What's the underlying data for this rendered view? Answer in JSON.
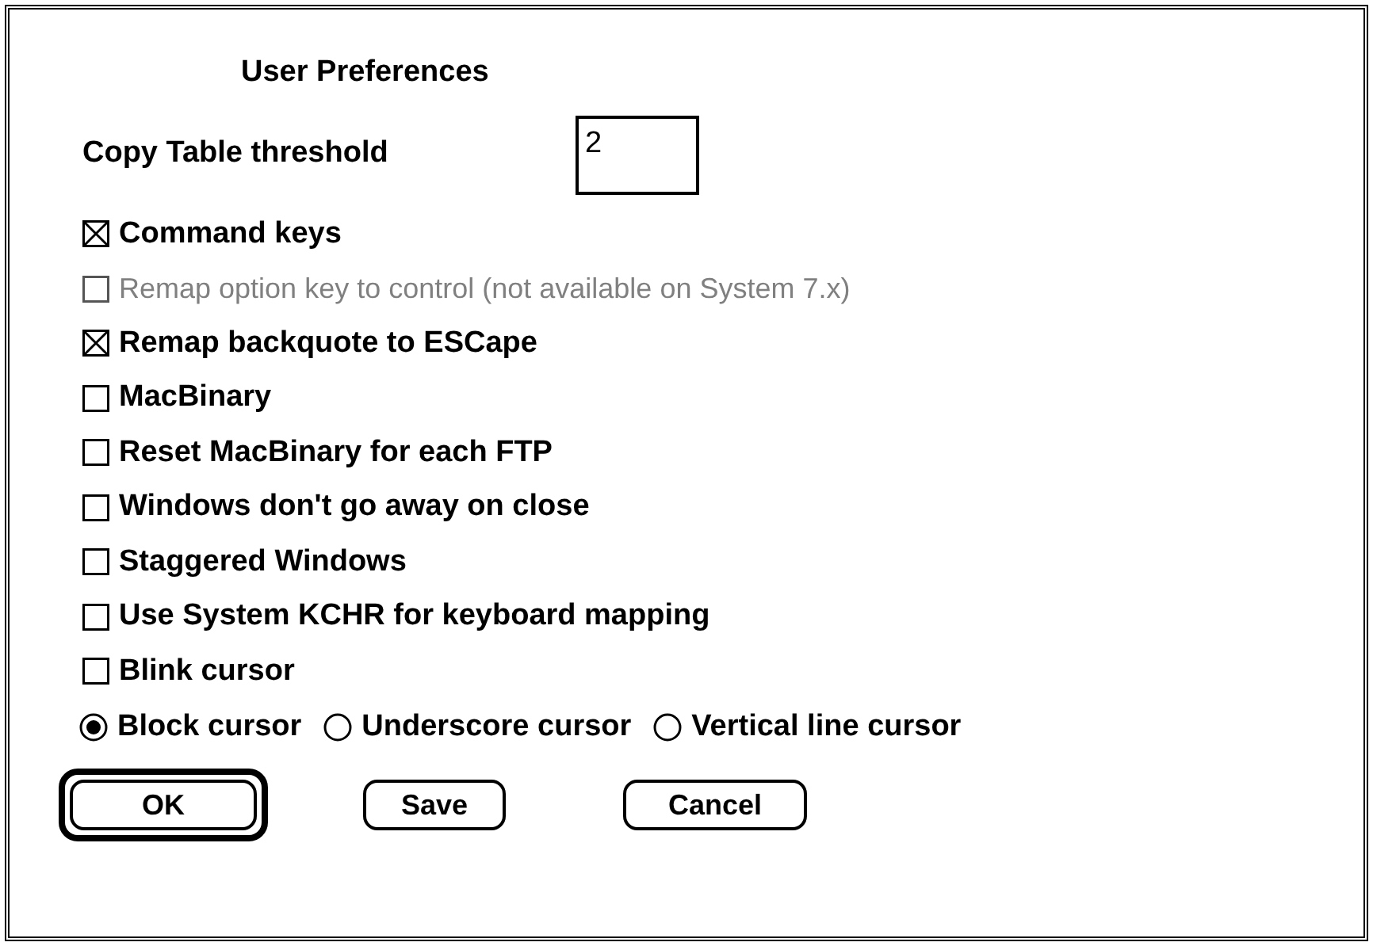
{
  "dialog": {
    "title": "User Preferences"
  },
  "threshold": {
    "label": "Copy Table threshold",
    "value": "2"
  },
  "options": [
    {
      "label": "Command keys",
      "checked": true,
      "disabled": false
    },
    {
      "label": "Remap option key to control (not available on System 7.x)",
      "checked": false,
      "disabled": true
    },
    {
      "label": "Remap backquote to ESCape",
      "checked": true,
      "disabled": false
    },
    {
      "label": "MacBinary",
      "checked": false,
      "disabled": false
    },
    {
      "label": "Reset MacBinary for each FTP",
      "checked": false,
      "disabled": false
    },
    {
      "label": "Windows don't go away on close",
      "checked": false,
      "disabled": false
    },
    {
      "label": "Staggered Windows",
      "checked": false,
      "disabled": false
    },
    {
      "label": "Use System KCHR for keyboard mapping",
      "checked": false,
      "disabled": false
    },
    {
      "label": "Blink cursor",
      "checked": false,
      "disabled": false
    }
  ],
  "cursor_options": [
    {
      "label": "Block cursor",
      "selected": true
    },
    {
      "label": "Underscore cursor",
      "selected": false
    },
    {
      "label": "Vertical line cursor",
      "selected": false
    }
  ],
  "buttons": [
    {
      "label": "OK",
      "default": true
    },
    {
      "label": "Save",
      "default": false
    },
    {
      "label": "Cancel",
      "default": false
    }
  ]
}
